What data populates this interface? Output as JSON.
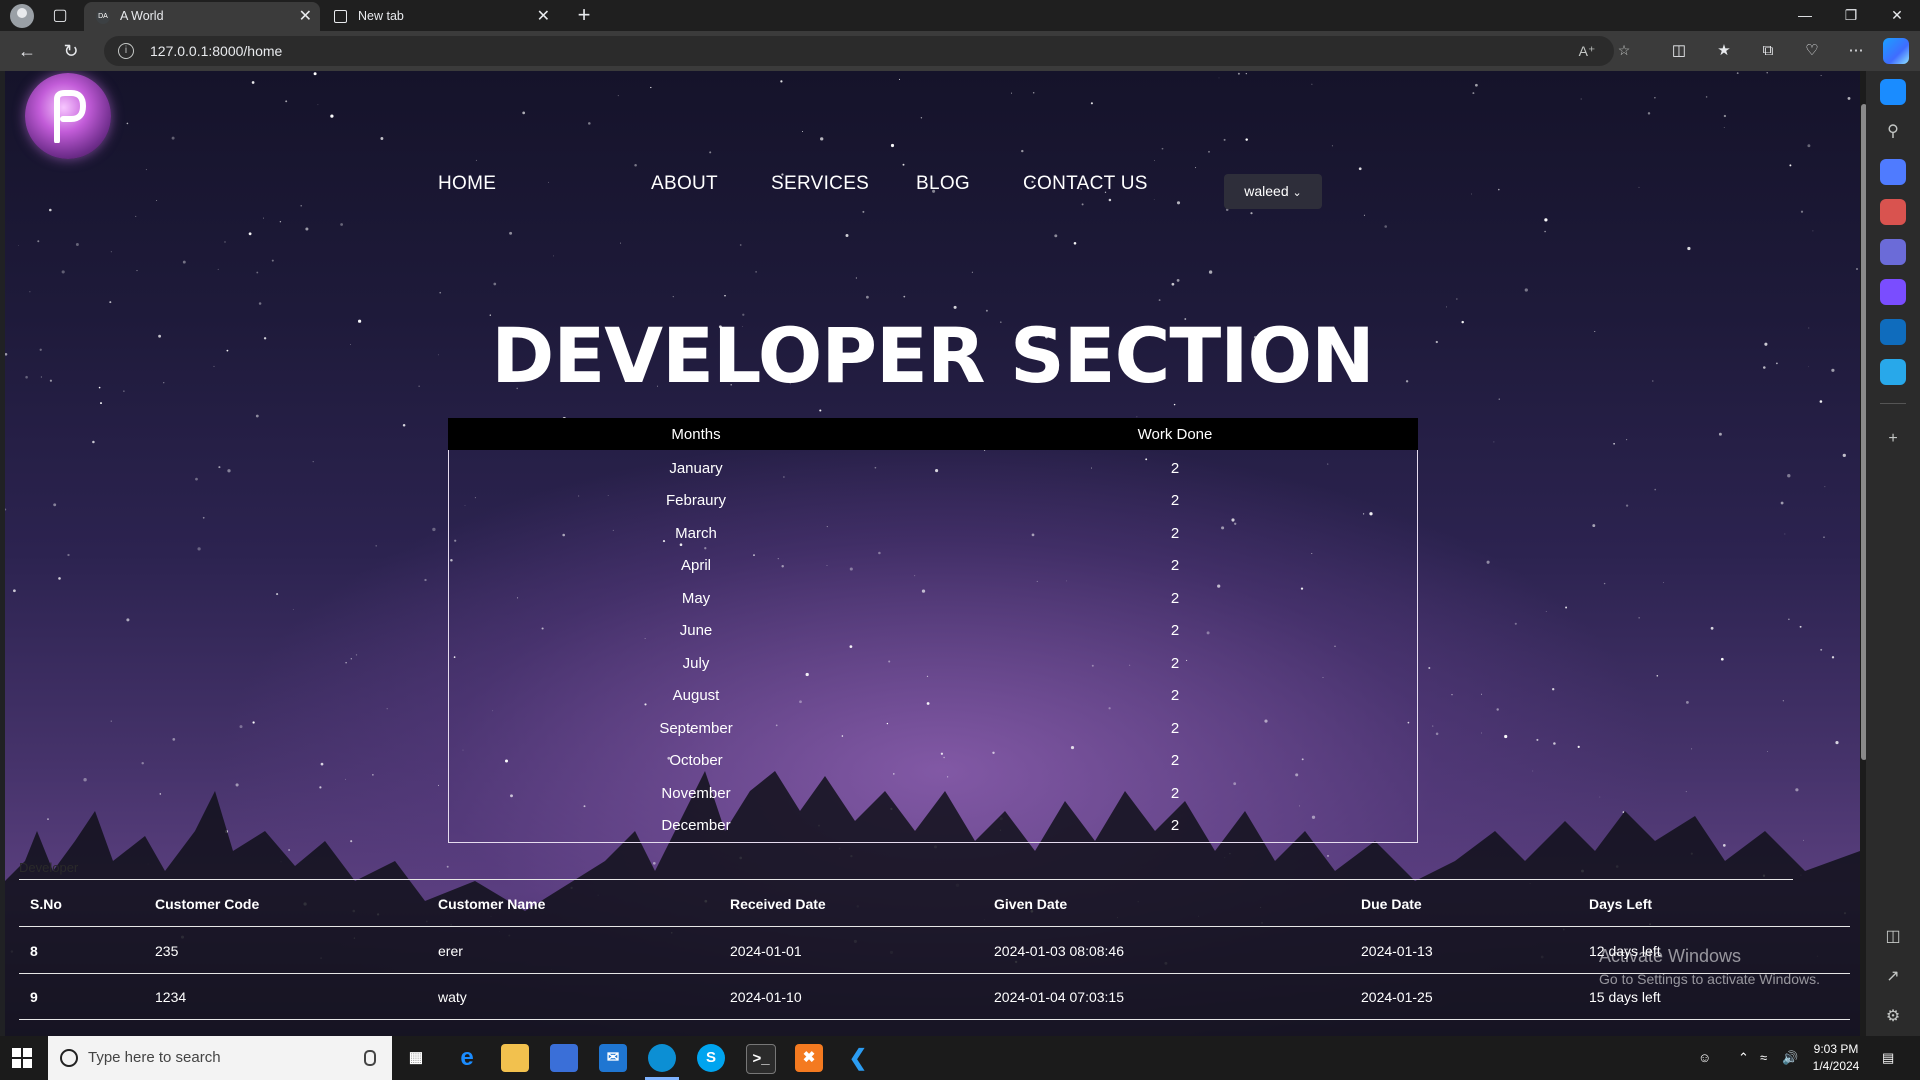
{
  "browser": {
    "tabs": [
      {
        "title": "A World",
        "favicon": "DA",
        "active": true
      },
      {
        "title": "New tab",
        "active": false
      }
    ],
    "url": "127.0.0.1:8000/home"
  },
  "page": {
    "nav": [
      "HOME",
      "ABOUT",
      "SERVICES",
      "BLOG",
      "CONTACT US"
    ],
    "user_menu": "waleed",
    "headline": "DEVELOPER SECTION",
    "months_table": {
      "headers": [
        "Months",
        "Work Done"
      ],
      "rows": [
        [
          "January",
          "2"
        ],
        [
          "Febraury",
          "2"
        ],
        [
          "March",
          "2"
        ],
        [
          "April",
          "2"
        ],
        [
          "May",
          "2"
        ],
        [
          "June",
          "2"
        ],
        [
          "July",
          "2"
        ],
        [
          "August",
          "2"
        ],
        [
          "September",
          "2"
        ],
        [
          "October",
          "2"
        ],
        [
          "November",
          "2"
        ],
        [
          "December",
          "2"
        ]
      ]
    },
    "developer_label": "Developer",
    "developer_table": {
      "headers": [
        "S.No",
        "Customer Code",
        "Customer Name",
        "Received Date",
        "Given Date",
        "Due Date",
        "Days Left"
      ],
      "rows": [
        [
          "8",
          "235",
          "erer",
          "2024-01-01",
          "2024-01-03 08:08:46",
          "2024-01-13",
          "12 days left"
        ],
        [
          "9",
          "1234",
          "waty",
          "2024-01-10",
          "2024-01-04 07:03:15",
          "2024-01-25",
          "15 days left"
        ]
      ]
    }
  },
  "watermark": {
    "title": "Activate Windows",
    "subtitle": "Go to Settings to activate Windows."
  },
  "taskbar": {
    "search_placeholder": "Type here to search",
    "time": "9:03 PM",
    "date": "1/4/2024"
  }
}
